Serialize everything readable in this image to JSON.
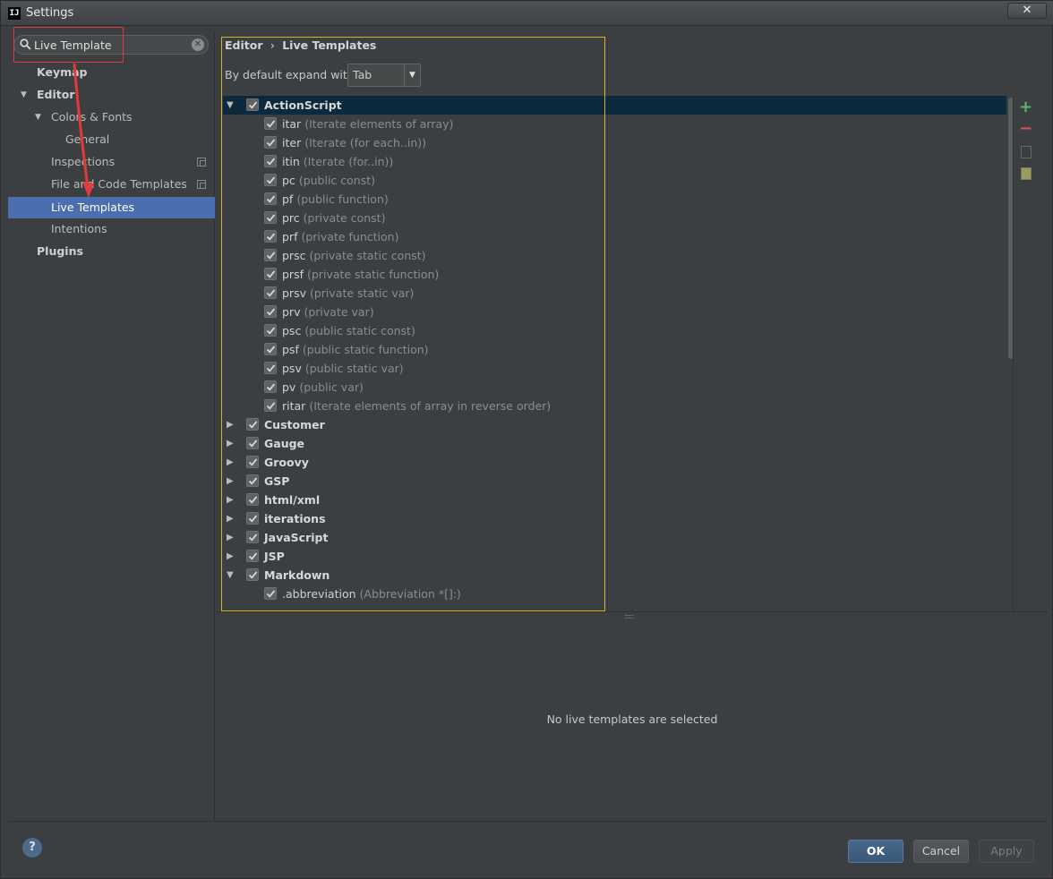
{
  "window": {
    "title": "Settings",
    "app_icon": "IJ",
    "close": "✕"
  },
  "search": {
    "value": "Live Template",
    "placeholder": ""
  },
  "sidebar": {
    "items": [
      {
        "label": "Keymap"
      },
      {
        "label": "Editor"
      },
      {
        "label": "Colors & Fonts"
      },
      {
        "label": "General"
      },
      {
        "label": "Inspections"
      },
      {
        "label": "File and Code Templates"
      },
      {
        "label": "Live Templates"
      },
      {
        "label": "Intentions"
      },
      {
        "label": "Plugins"
      }
    ]
  },
  "header": {
    "breadcrumb_parent": "Editor",
    "breadcrumb_sep": "›",
    "breadcrumb_current": "Live Templates",
    "expand_label": "By default expand with",
    "expand_value": "Tab"
  },
  "tree": {
    "actionscript": {
      "name": "ActionScript",
      "items": [
        {
          "abbr": "itar",
          "desc": "(Iterate elements of array)"
        },
        {
          "abbr": "iter",
          "desc": "(Iterate (for each..in))"
        },
        {
          "abbr": "itin",
          "desc": "(Iterate (for..in))"
        },
        {
          "abbr": "pc",
          "desc": "(public const)"
        },
        {
          "abbr": "pf",
          "desc": "(public function)"
        },
        {
          "abbr": "prc",
          "desc": "(private const)"
        },
        {
          "abbr": "prf",
          "desc": "(private function)"
        },
        {
          "abbr": "prsc",
          "desc": "(private static const)"
        },
        {
          "abbr": "prsf",
          "desc": "(private static function)"
        },
        {
          "abbr": "prsv",
          "desc": "(private static var)"
        },
        {
          "abbr": "prv",
          "desc": "(private var)"
        },
        {
          "abbr": "psc",
          "desc": "(public static const)"
        },
        {
          "abbr": "psf",
          "desc": "(public static function)"
        },
        {
          "abbr": "psv",
          "desc": "(public static var)"
        },
        {
          "abbr": "pv",
          "desc": "(public var)"
        },
        {
          "abbr": "ritar",
          "desc": "(Iterate elements of array in reverse order)"
        }
      ]
    },
    "groups": [
      {
        "name": "Customer"
      },
      {
        "name": "Gauge"
      },
      {
        "name": "Groovy"
      },
      {
        "name": "GSP"
      },
      {
        "name": "html/xml"
      },
      {
        "name": "iterations"
      },
      {
        "name": "JavaScript"
      },
      {
        "name": "JSP"
      }
    ],
    "markdown": {
      "name": "Markdown",
      "items": [
        {
          "abbr": ".abbreviation",
          "desc": "(Abbreviation *[]:)"
        }
      ]
    }
  },
  "detail": {
    "empty_message": "No live templates are selected"
  },
  "buttons": {
    "ok": "OK",
    "cancel": "Cancel",
    "apply": "Apply",
    "help": "?"
  },
  "colors": {
    "selection": "#4b6eaf",
    "highlight_frame": "#e0b020",
    "annotation": "#e23a3a"
  }
}
